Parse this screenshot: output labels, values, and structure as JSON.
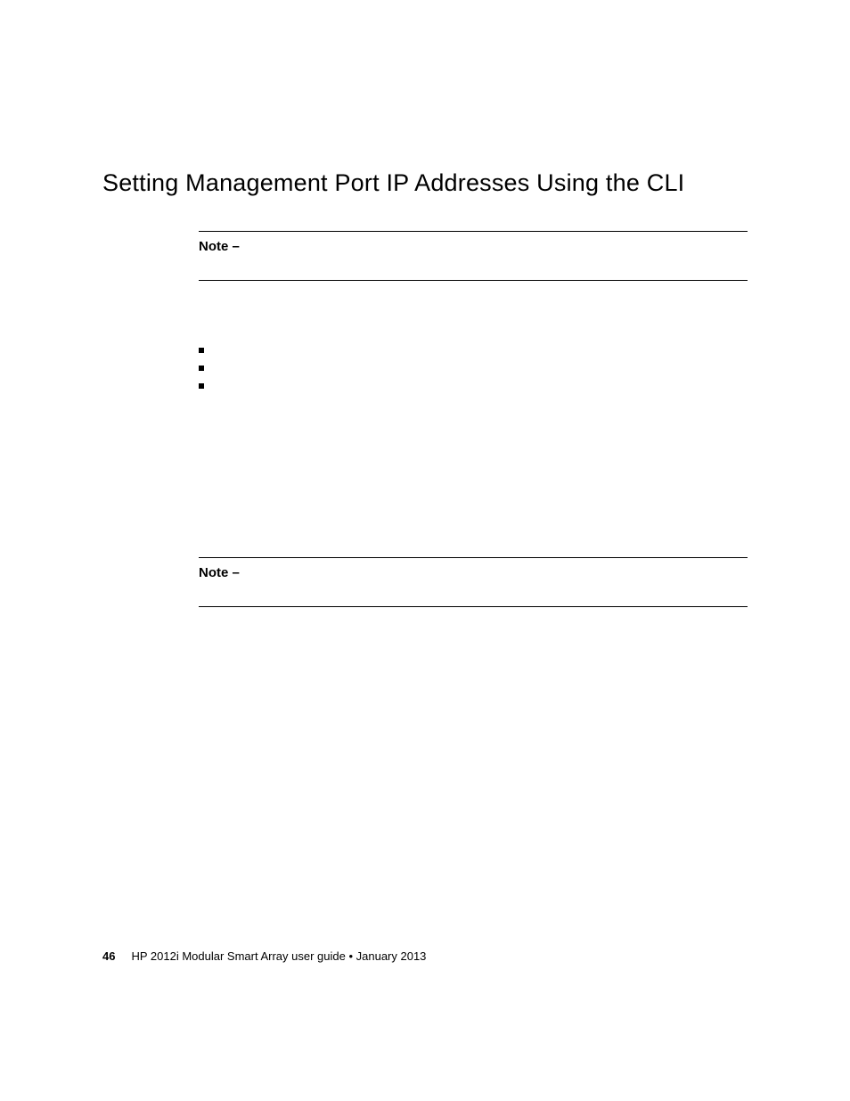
{
  "heading": "Setting Management Port IP Addresses Using the CLI",
  "note1": {
    "label": "Note –"
  },
  "bullets": {
    "item1": "",
    "item2": "",
    "item3": ""
  },
  "note2": {
    "label": "Note –"
  },
  "footer": {
    "page": "46",
    "text": "HP 2012i Modular Smart Array user guide • January 2013"
  }
}
